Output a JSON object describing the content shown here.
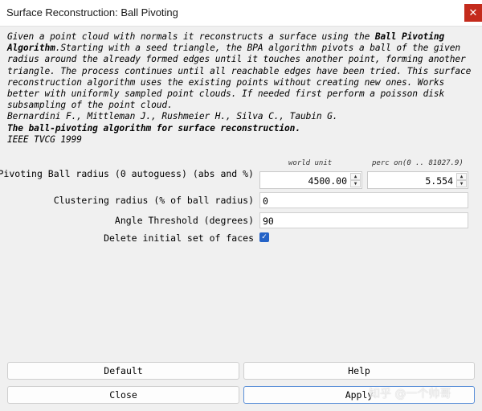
{
  "window": {
    "title": "Surface Reconstruction: Ball Pivoting",
    "close_glyph": "✕"
  },
  "description": {
    "intro": "Given a point cloud with normals it reconstructs a surface using the ",
    "method_name": "Ball Pivoting Algorithm",
    "body": ".Starting with a seed triangle, the BPA algorithm pivots a ball of the given radius around the already formed edges until it touches another point, forming another triangle. The process continues until all reachable edges have been tried. This surface reconstruction algorithm uses the existing points without creating new ones. Works better with uniformly sampled point clouds. If needed first perform a poisson disk subsampling of the point cloud.",
    "authors": "Bernardini F., Mittleman J., Rushmeier H., Silva C., Taubin G.",
    "paper_title": "The ball-pivoting algorithm for surface reconstruction.",
    "venue": "IEEE TVCG 1999"
  },
  "params": {
    "ball_radius": {
      "label": "Pivoting Ball radius (0 autoguess) (abs and %)",
      "world_unit_label": "world unit",
      "perc_label": "perc on(0 .. 81027.9)",
      "world_value": "4500.00",
      "perc_value": "5.554"
    },
    "clustering": {
      "label": "Clustering radius (% of ball radius)",
      "value": "0"
    },
    "angle": {
      "label": "Angle Threshold (degrees)",
      "value": "90"
    },
    "delete_faces": {
      "label": "Delete initial set of faces",
      "checked": true,
      "check_glyph": "✓"
    }
  },
  "spin_arrows": {
    "up": "▲",
    "down": "▼"
  },
  "buttons": {
    "default": "Default",
    "help": "Help",
    "close": "Close",
    "apply": "Apply"
  },
  "watermark": "知乎 @一个帅哥"
}
